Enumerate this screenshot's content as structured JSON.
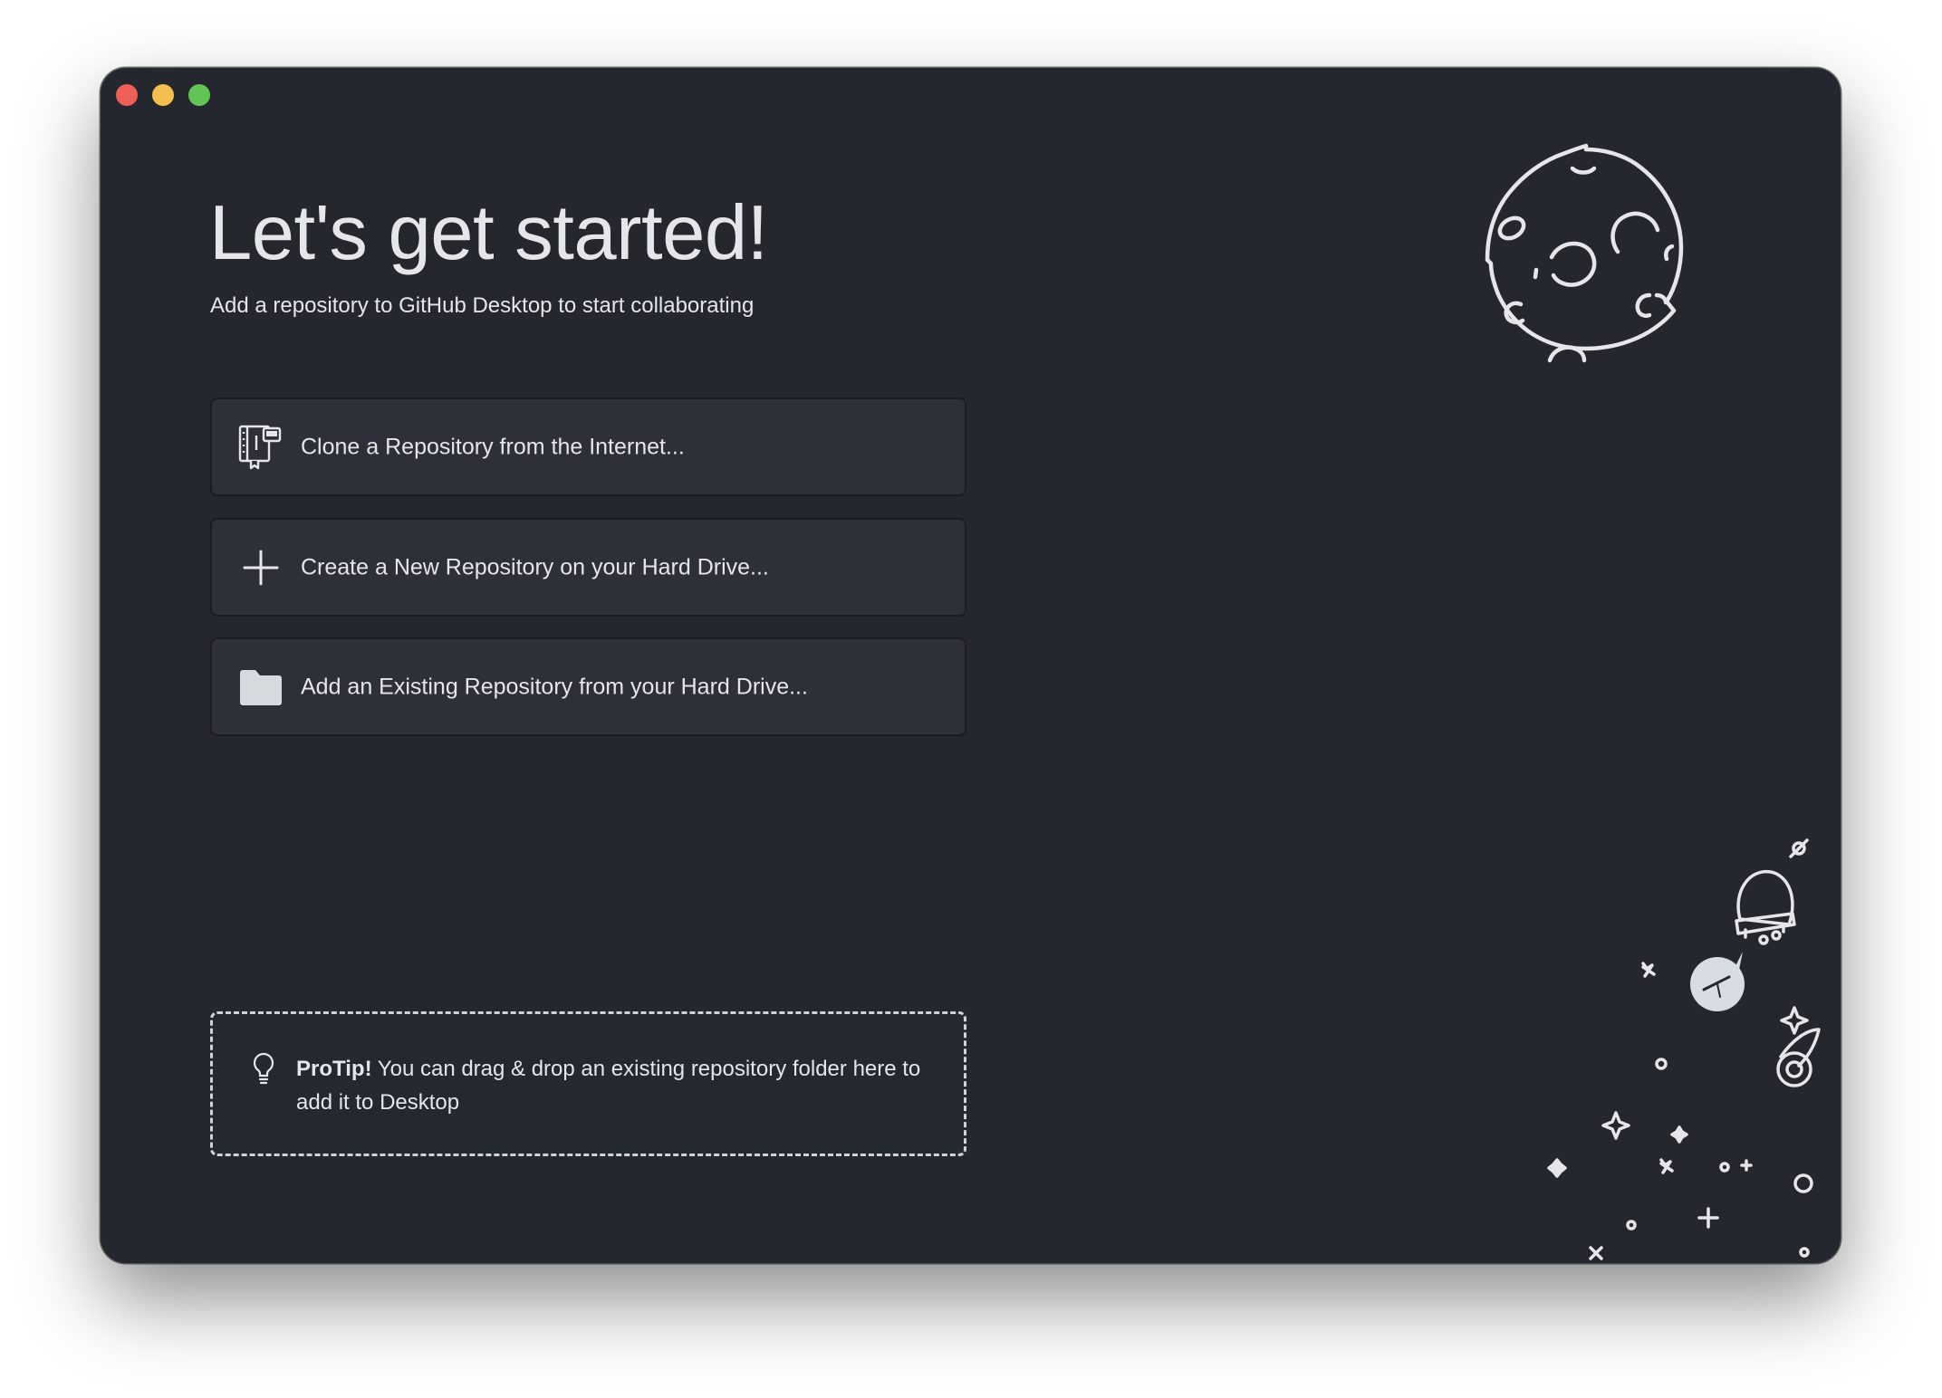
{
  "window": {
    "controls": [
      "close",
      "minimize",
      "zoom"
    ]
  },
  "header": {
    "title": "Let's get started!",
    "subtitle": "Add a repository to GitHub Desktop to start collaborating"
  },
  "actions": [
    {
      "label": "Clone a Repository from the Internet...",
      "icon": "repo-clone-icon"
    },
    {
      "label": "Create a New Repository on your Hard Drive...",
      "icon": "plus-icon"
    },
    {
      "label": "Add an Existing Repository from your Hard Drive...",
      "icon": "folder-icon"
    }
  ],
  "protip": {
    "lead": "ProTip!",
    "text": " You can drag & drop an existing repository folder here to add it to Desktop",
    "icon": "lightbulb-icon"
  },
  "colors": {
    "window_bg": "#24272d",
    "button_bg": "#2d3038",
    "text": "#e4e6ea",
    "close": "#ee5f57",
    "minimize": "#f5bf4f",
    "zoom": "#61c454"
  }
}
